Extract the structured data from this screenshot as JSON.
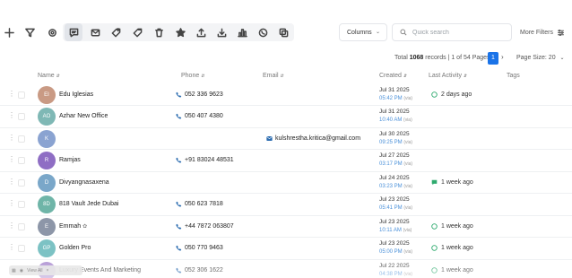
{
  "toolbar": {
    "columns_label": "Columns",
    "search_placeholder": "Quick search",
    "more_filters_label": "More Filters"
  },
  "pagination": {
    "total_prefix": "Total",
    "total_count": "1068",
    "records_label": "records",
    "page_info": "| 1 of 54 Pages",
    "current_page": "1",
    "page_size_label": "Page Size: 20"
  },
  "columns": [
    "Name",
    "Phone",
    "Email",
    "Created",
    "Last Activity",
    "Tags"
  ],
  "colors": {
    "accent": "#1a73e8",
    "phone_icon": "#2b6cb0",
    "activity_green": "#2eaa6e"
  },
  "rows": [
    {
      "initials": "EI",
      "avatar_color": "#c99a84",
      "name": "Edu Iglesias",
      "phone": "052 336 9623",
      "email": "",
      "created_date": "Jul 31 2025",
      "created_time": "05:42 PM",
      "via": "(via)",
      "activity": "2 days ago",
      "activity_icon": "whatsapp-icon"
    },
    {
      "initials": "AO",
      "avatar_color": "#7fb8b5",
      "name": "Azhar New Office",
      "phone": "050 407 4380",
      "email": "",
      "created_date": "Jul 31 2025",
      "created_time": "10:40 AM",
      "via": "(via)",
      "activity": "",
      "activity_icon": ""
    },
    {
      "initials": "K",
      "avatar_color": "#8aa3d1",
      "name": "",
      "phone": "",
      "email": "kulshrestha.kritica@gmail.com",
      "created_date": "Jul 30 2025",
      "created_time": "09:25 PM",
      "via": "(via)",
      "activity": "",
      "activity_icon": ""
    },
    {
      "initials": "R",
      "avatar_color": "#8f6ec4",
      "name": "Ramjas",
      "phone": "+91 83024 48531",
      "email": "",
      "created_date": "Jul 27 2025",
      "created_time": "03:17 PM",
      "via": "(via)",
      "activity": "",
      "activity_icon": ""
    },
    {
      "initials": "D",
      "avatar_color": "#7aa7c9",
      "name": "Divyangnasaxena",
      "phone": "",
      "email": "",
      "created_date": "Jul 24 2025",
      "created_time": "03:23 PM",
      "via": "(via)",
      "activity": "1 week ago",
      "activity_icon": "message-icon"
    },
    {
      "initials": "8D",
      "avatar_color": "#6fb5a8",
      "name": "818 Vault Jede Dubai",
      "phone": "050 623 7818",
      "email": "",
      "created_date": "Jul 23 2025",
      "created_time": "05:41 PM",
      "via": "(via)",
      "activity": "",
      "activity_icon": ""
    },
    {
      "initials": "E",
      "avatar_color": "#8d96a8",
      "name": "Emmah",
      "phone": "+44 7872 063807",
      "email": "",
      "created_date": "Jul 23 2025",
      "created_time": "10:11 AM",
      "via": "(via)",
      "activity": "1 week ago",
      "activity_icon": "whatsapp-icon"
    },
    {
      "initials": "GP",
      "avatar_color": "#7cc2c4",
      "name": "Golden Pro",
      "phone": "050 770 9463",
      "email": "",
      "created_date": "Jul 23 2025",
      "created_time": "05:00 PM",
      "via": "(via)",
      "activity": "1 week ago",
      "activity_icon": "whatsapp-icon"
    },
    {
      "initials": "LE",
      "avatar_color": "#a98bcf",
      "name": "Luxury Events And Marketing",
      "phone": "052 306 1622",
      "email": "",
      "created_date": "Jul 22 2025",
      "created_time": "04:38 PM",
      "via": "(via)",
      "activity": "1 week ago",
      "activity_icon": "whatsapp-icon"
    }
  ],
  "bottom_bar": {
    "label": "View All"
  }
}
